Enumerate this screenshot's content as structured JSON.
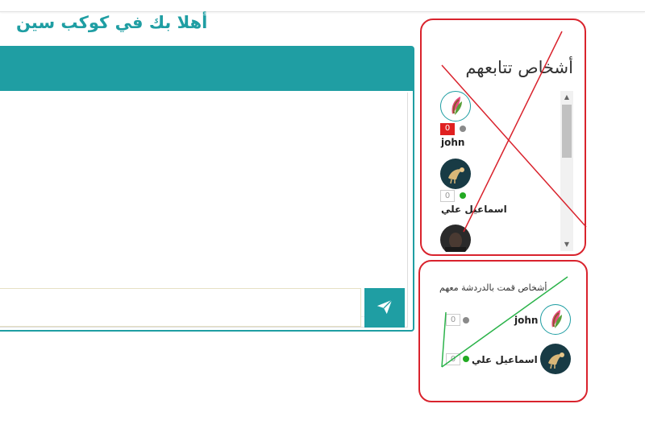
{
  "header": {
    "welcome": "أهلا بك في كوكب سين"
  },
  "chat": {
    "input_value": "",
    "send_icon": "paper-plane-icon"
  },
  "following": {
    "title": "أشخاص تتابعهم",
    "contacts": [
      {
        "name": "john",
        "unread": "0",
        "badge_style": "red",
        "status": "gray",
        "avatar": "feather-logo"
      },
      {
        "name": "اسماعيل علي",
        "unread": "0",
        "badge_style": "plain",
        "status": "green",
        "avatar": "bird-logo"
      },
      {
        "name": "",
        "unread": "",
        "status": "",
        "avatar": "dark-photo"
      }
    ]
  },
  "chatted": {
    "title": "أشخاص قمت بالدردشة معهم",
    "contacts": [
      {
        "name": "john",
        "unread": "0",
        "status": "gray",
        "avatar": "feather-logo"
      },
      {
        "name": "اسماعيل علي",
        "unread": "0",
        "status": "green",
        "avatar": "bird-logo"
      }
    ]
  },
  "colors": {
    "accent": "#1f9ea3",
    "annotation_red": "#d9232d",
    "annotation_green": "#2bb34a",
    "badge_red": "#e02020",
    "online": "#22aa22",
    "offline": "#8a8a8a"
  }
}
